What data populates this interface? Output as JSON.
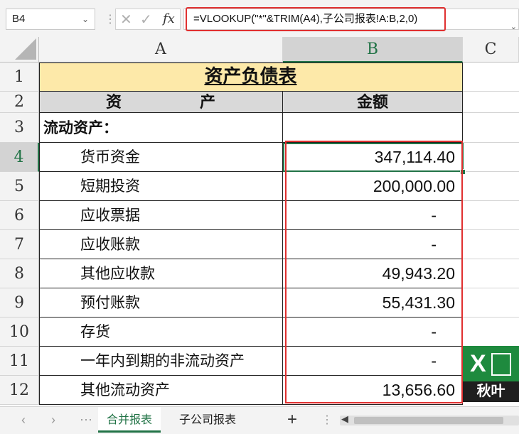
{
  "formula_bar": {
    "name_box": "B4",
    "formula": "=VLOOKUP(\"*\"&TRIM(A4),子公司报表!A:B,2,0)",
    "cancel_icon": "close-icon",
    "enter_icon": "check-icon",
    "fx_label": "fx"
  },
  "columns": [
    "A",
    "B",
    "C"
  ],
  "rows": [
    "1",
    "2",
    "3",
    "4",
    "5",
    "6",
    "7",
    "8",
    "9",
    "10",
    "11",
    "12"
  ],
  "sheet": {
    "title": "资产负债表",
    "header_asset": "资　　　　　产",
    "header_amount": "金额",
    "section": "流动资产：",
    "items": [
      {
        "label": "货币资金",
        "amount": "347,114.40"
      },
      {
        "label": "短期投资",
        "amount": "200,000.00"
      },
      {
        "label": "应收票据",
        "amount": "-"
      },
      {
        "label": "应收账款",
        "amount": "-"
      },
      {
        "label": "其他应收款",
        "amount": "49,943.20"
      },
      {
        "label": "预付账款",
        "amount": "55,431.30"
      },
      {
        "label": "存货",
        "amount": "-"
      },
      {
        "label": "一年内到期的非流动资产",
        "amount": "-"
      },
      {
        "label": "其他流动资产",
        "amount": "13,656.60"
      }
    ]
  },
  "tabs": {
    "items": [
      "合并报表",
      "子公司报表"
    ],
    "active": "合并报表",
    "add": "+"
  },
  "logo": {
    "caption": "秋叶",
    "letter": "X"
  },
  "colors": {
    "accent": "#217346",
    "highlight": "#e03030",
    "title_fill": "#fde9a9",
    "header_fill": "#d9d9d9"
  }
}
